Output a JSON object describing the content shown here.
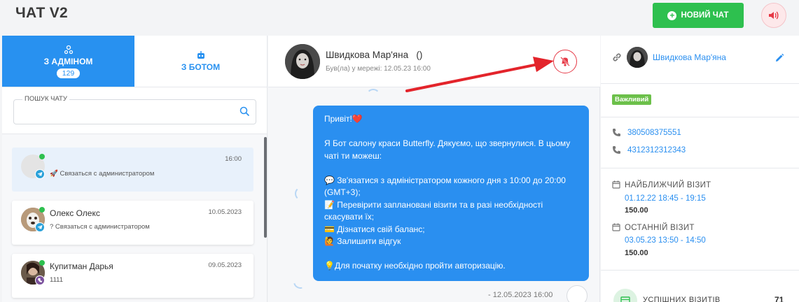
{
  "header": {
    "title": "ЧАТ V2",
    "new_chat_label": "НОВИЙ ЧАТ",
    "icons": {
      "new_chat": "plus-circle-icon",
      "sound": "volume-icon"
    }
  },
  "left": {
    "tabs": [
      {
        "label": "З АДМІНОМ",
        "badge": "129",
        "icon": "users-icon",
        "active": true
      },
      {
        "label": "З БОТОМ",
        "icon": "robot-icon",
        "active": false
      }
    ],
    "search": {
      "label": "ПОШУК ЧАТУ",
      "value": "",
      "placeholder": ""
    },
    "chats": [
      {
        "name": "",
        "preview": "🚀 Связаться с администратором",
        "time": "16:00",
        "channel": "telegram",
        "online": true,
        "selected": true
      },
      {
        "name": "Олекс Олекс",
        "preview": "? Связаться с администратором",
        "time": "10.05.2023",
        "channel": "telegram",
        "online": true,
        "selected": false
      },
      {
        "name": "Купитман Дарья",
        "preview": "1111",
        "time": "09.05.2023",
        "channel": "viber",
        "online": true,
        "selected": false
      }
    ]
  },
  "conversation": {
    "name": "Швидкова Мар'яна",
    "name_suffix": "()",
    "status": "Був(ла) у мережі: 12.05.23 16:00",
    "mute_icon": "bell-slash-icon",
    "message_lines": [
      "Привіт!❤️",
      "",
      "Я Бот салону краси Butterfly. Дякуємо, що звернулися. В цьому",
      "чаті ти можеш:",
      "",
      "💬 Зв'язатися з адміністратором кожного дня з 10:00 до 20:00",
      "(GMT+3);",
      "📝 Перевірити заплановані візити та в разі необхідності",
      "скасувати їх;",
      "💳 Дізнатися свій баланс;",
      "🙋 Залишити відгук",
      "",
      "💡Для початку необхідно пройти авторизацію."
    ],
    "message_meta": "-  12.05.2023 16:00"
  },
  "right": {
    "client_name": "Швидкова Мар'яна",
    "tag": "Важливий",
    "phones": [
      "380508375551",
      "4312312312343"
    ],
    "nearest_visit": {
      "label": "НАЙБЛИЖЧИЙ ВІЗИТ",
      "time": "01.12.22 18:45 - 19:15",
      "price": "150.00"
    },
    "last_visit": {
      "label": "ОСТАННІЙ ВІЗИТ",
      "time": "03.05.23 13:50 - 14:50",
      "price": "150.00"
    },
    "stats": {
      "label": "УСПІШНИХ ВІЗИТІВ",
      "value": "71"
    }
  },
  "colors": {
    "primary": "#2891f0",
    "success": "#2ec04f",
    "danger": "#e63946",
    "tag": "#6cc04a"
  }
}
